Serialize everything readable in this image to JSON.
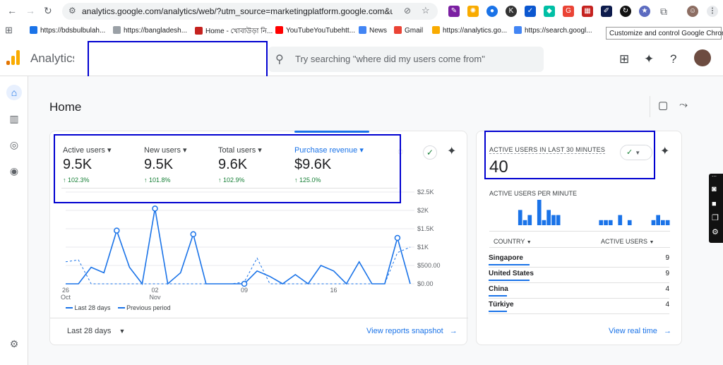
{
  "browser": {
    "url": "analytics.google.com/analytics/web/?utm_source=marketingplatform.google.com&utm_medi...",
    "tooltip": "Customize and control Google Chrome",
    "bookmarks": [
      {
        "label": "https://bdsbulbulah...",
        "color": "#1a73e8"
      },
      {
        "label": "https://bangladesh...",
        "color": "#9aa0a6"
      },
      {
        "label": "Home - খোবাউড়া নি...",
        "color": "#c5221f"
      },
      {
        "label": "YouTubeYouTubehtt...",
        "color": "#ff0000"
      },
      {
        "label": "News",
        "color": "#4285f4"
      },
      {
        "label": "Gmail",
        "color": "#ea4335"
      },
      {
        "label": "https://analytics.go...",
        "color": "#f9ab00"
      },
      {
        "label": "https://search.googl...",
        "color": "#4285f4"
      }
    ]
  },
  "header": {
    "product": "Analytics",
    "search_placeholder": "Try searching \"where did my users come from\""
  },
  "page": {
    "title": "Home"
  },
  "metrics": [
    {
      "label": "Active users",
      "value": "9.5K",
      "delta": "↑ 102.3%"
    },
    {
      "label": "New users",
      "value": "9.5K",
      "delta": "↑ 101.8%"
    },
    {
      "label": "Total users",
      "value": "9.6K",
      "delta": "↑ 102.9%"
    },
    {
      "label": "Purchase revenue",
      "value": "$9.6K",
      "delta": "↑ 125.0%"
    }
  ],
  "chart_data": {
    "type": "line",
    "ylim": [
      0,
      2500
    ],
    "yticks": [
      "$0.00",
      "$500.00",
      "$1K",
      "$1.5K",
      "$2K",
      "$2.5K"
    ],
    "xticks": [
      {
        "label": "26",
        "sub": "Oct",
        "index": 0
      },
      {
        "label": "02",
        "sub": "Nov",
        "index": 7
      },
      {
        "label": "09",
        "sub": "",
        "index": 14
      },
      {
        "label": "16",
        "sub": "",
        "index": 21
      }
    ],
    "series": [
      {
        "name": "Last 28 days",
        "style": "solid",
        "color": "#1a73e8",
        "values": [
          0,
          0,
          450,
          300,
          1450,
          450,
          0,
          2050,
          0,
          300,
          1350,
          0,
          0,
          0,
          0,
          350,
          200,
          0,
          250,
          0,
          500,
          350,
          0,
          600,
          0,
          0,
          1250,
          0
        ],
        "markers": [
          4,
          7,
          10,
          14,
          26
        ]
      },
      {
        "name": "Previous period",
        "style": "dashed",
        "color": "#1a73e8",
        "values": [
          600,
          650,
          0,
          0,
          0,
          0,
          0,
          0,
          0,
          0,
          0,
          0,
          0,
          0,
          50,
          700,
          0,
          0,
          0,
          0,
          0,
          0,
          0,
          0,
          0,
          0,
          850,
          1000
        ]
      }
    ]
  },
  "left_card": {
    "date_range": "Last 28 days",
    "link": "View reports snapshot"
  },
  "realtime": {
    "heading": "ACTIVE USERS IN LAST 30 MINUTES",
    "count": "40",
    "per_minute_label": "ACTIVE USERS PER MINUTE",
    "per_minute": [
      0,
      0,
      0,
      0,
      0,
      0,
      3,
      1,
      2,
      0,
      5,
      1,
      3,
      2,
      2,
      0,
      0,
      0,
      0,
      0,
      0,
      0,
      0,
      1,
      1,
      1,
      0,
      2,
      0,
      1,
      0,
      0,
      0,
      0,
      1,
      2,
      1,
      1
    ],
    "country_header": "COUNTRY",
    "users_header": "ACTIVE USERS",
    "rows": [
      {
        "country": "Singapore",
        "users": "9",
        "share": 1.0
      },
      {
        "country": "United States",
        "users": "9",
        "share": 1.0
      },
      {
        "country": "China",
        "users": "4",
        "share": 0.44
      },
      {
        "country": "Türkiye",
        "users": "4",
        "share": 0.44
      }
    ],
    "link": "View real time"
  },
  "colors": {
    "accent": "#1a73e8",
    "positive": "#188038",
    "highlight_box": "#0000d0"
  }
}
